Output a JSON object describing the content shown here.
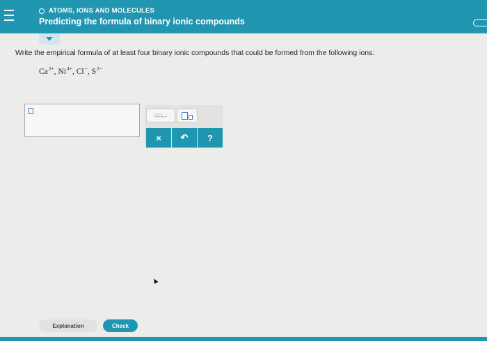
{
  "header": {
    "topic": "ATOMS, IONS AND MOLECULES",
    "title": "Predicting the formula of binary ionic compounds"
  },
  "question": {
    "prompt": "Write the empirical formula of at least four binary ionic compounds that could be formed from the following ions:",
    "ions": [
      {
        "symbol": "Ca",
        "charge": "2+",
        "sep": ", "
      },
      {
        "symbol": "Ni",
        "charge": "4+",
        "sep": ", "
      },
      {
        "symbol": "Cl",
        "charge": "−",
        "sep": ", "
      },
      {
        "symbol": "S",
        "charge": "2−",
        "sep": ""
      }
    ]
  },
  "toolbar": {
    "charge_sep": "□,□,...",
    "clear_label": "×",
    "undo_label": "↶",
    "help_label": "?"
  },
  "footer": {
    "explanation_label": "Explanation",
    "check_label": "Check"
  },
  "colors": {
    "accent": "#2196b0",
    "page_bg": "#ecedeb"
  }
}
